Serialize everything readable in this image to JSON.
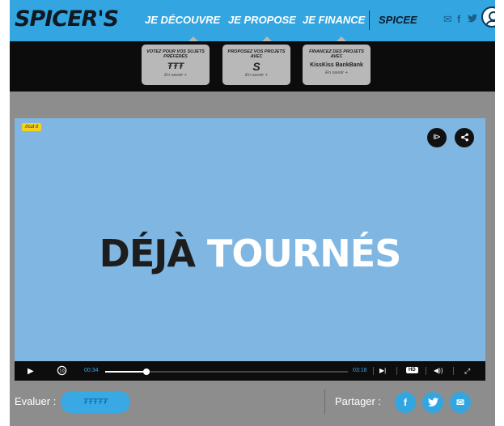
{
  "header": {
    "logo": "SPICER'S",
    "nav": [
      {
        "label": "JE DÉCOUVRE"
      },
      {
        "label": "JE PROPOSE"
      },
      {
        "label": "JE FINANCE"
      },
      {
        "label": "SPICEE"
      }
    ],
    "icons": [
      "mail-icon",
      "facebook-icon",
      "twitter-icon",
      "user-icon"
    ]
  },
  "dropdown": {
    "cards": [
      {
        "title": "VOTEZ POUR VOS SUJETS PRÉFÉRÉS",
        "mark": "ŦŦŦ",
        "link": "En savoir +"
      },
      {
        "title": "PROPOSEZ VOS PROJETS AVEC",
        "mark": "S",
        "link": "En savoir +"
      },
      {
        "title": "FINANCEZ DES PROJETS AVEC",
        "mark": "KissKiss BankBank",
        "link": "En savoir +"
      }
    ]
  },
  "video": {
    "tag": "//cut it",
    "title_part1": "DÉJÀ",
    "title_part2": "TOURNÉS",
    "current_time": "00:34",
    "duration": "03:18",
    "progress": 0.17,
    "quality": "HD"
  },
  "rating": {
    "label": "Evaluer :",
    "icons": "ŦŦŦŦŦ"
  },
  "share": {
    "label": "Partager :",
    "facebook": "f",
    "twitter": "t",
    "mail": "✉"
  },
  "colors": {
    "accent": "#33a6e2",
    "video_bg": "#7fb6e2",
    "tag": "#f5d31c"
  }
}
